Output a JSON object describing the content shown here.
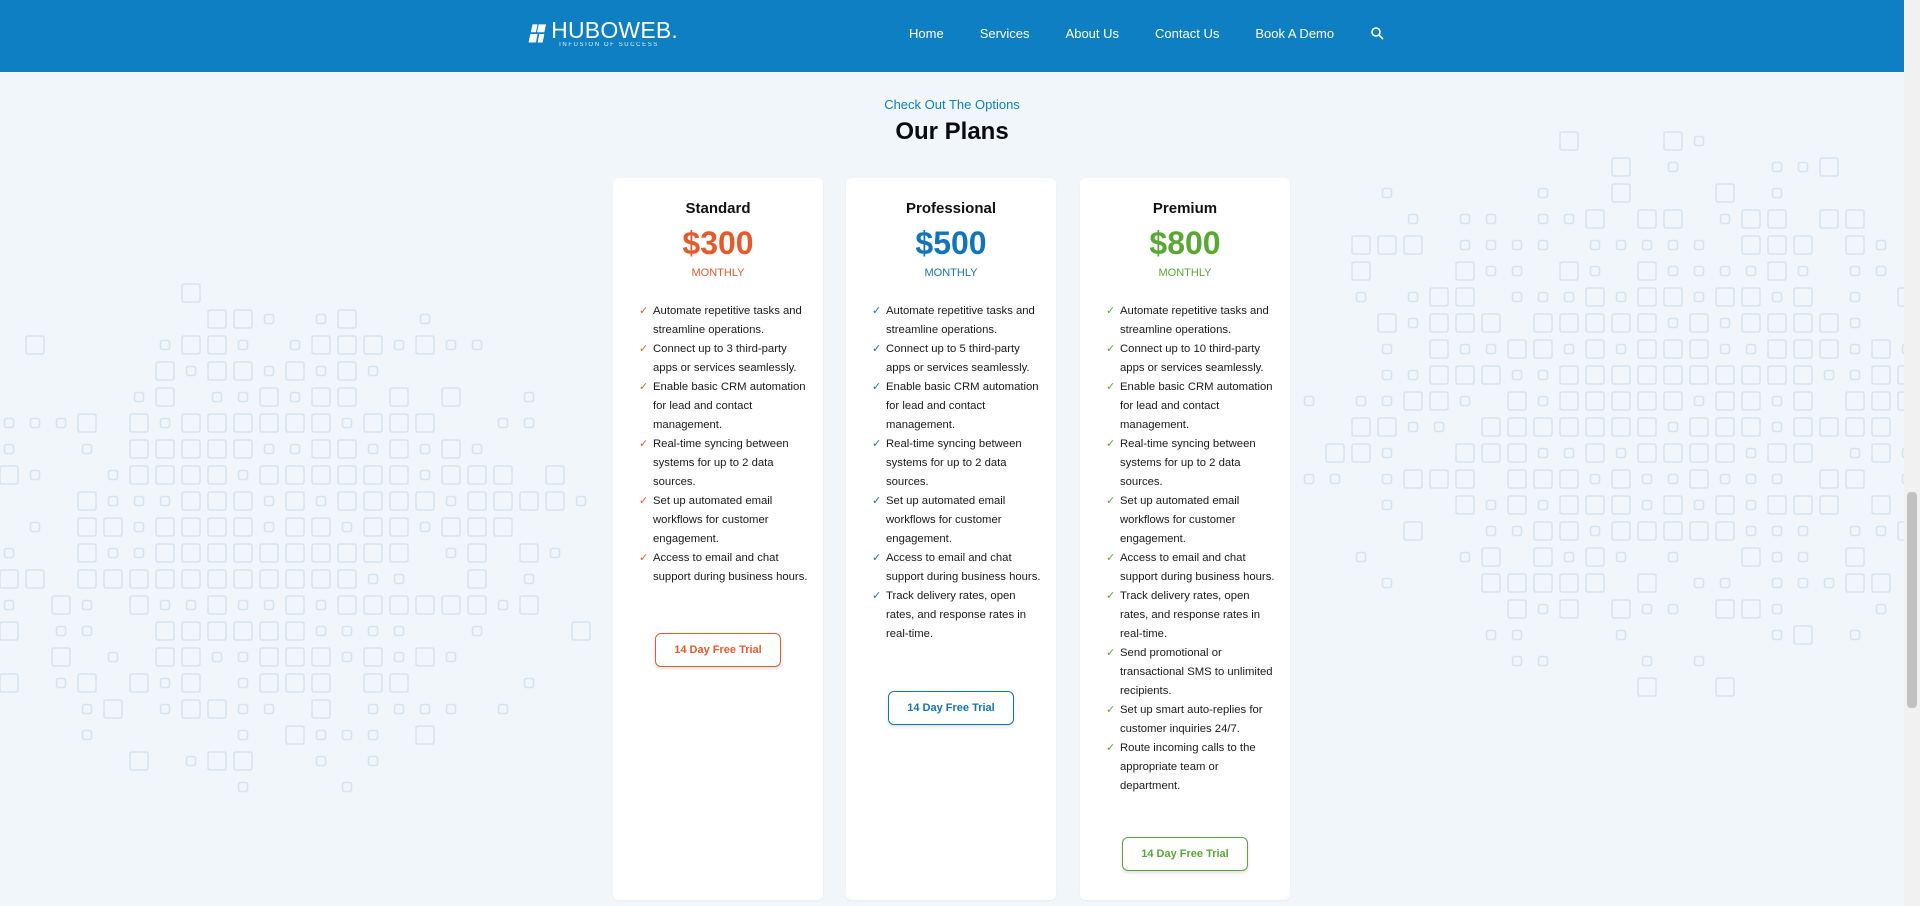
{
  "brand": {
    "name": "HUBOWEB.",
    "tagline": "INFUSION OF SUCCESS"
  },
  "nav": {
    "links": [
      "Home",
      "Services",
      "About Us",
      "Contact Us",
      "Book A Demo"
    ],
    "search_icon": "search-icon"
  },
  "section": {
    "kicker": "Check Out The Options",
    "title": "Our Plans"
  },
  "colors": {
    "nav_bg": "#0d7fc2",
    "standard": "#e55a2b",
    "professional": "#1274b9",
    "premium": "#5aa834"
  },
  "plans": [
    {
      "name": "Standard",
      "price": "$300",
      "period": "MONTHLY",
      "features": [
        "Automate repetitive tasks and streamline operations.",
        "Connect up to 3 third-party apps or services seamlessly.",
        "Enable basic CRM automation for lead and contact management.",
        "Real-time syncing between systems for up to 2 data sources.",
        "Set up automated email workflows for customer engagement.",
        "Access to email and chat support during business hours."
      ],
      "cta": "14 Day Free Trial"
    },
    {
      "name": "Professional",
      "price": "$500",
      "period": "MONTHLY",
      "features": [
        "Automate repetitive tasks and streamline operations.",
        "Connect up to 5 third-party apps or services seamlessly.",
        "Enable basic CRM automation for lead and contact management.",
        "Real-time syncing between systems for up to 2 data sources.",
        "Set up automated email workflows for customer engagement.",
        "Access to email and chat support during business hours.",
        "Track delivery rates, open rates, and response rates in real-time."
      ],
      "cta": "14 Day Free Trial"
    },
    {
      "name": "Premium",
      "price": "$800",
      "period": "MONTHLY",
      "features": [
        "Automate repetitive tasks and streamline operations.",
        "Connect up to 10 third-party apps or services seamlessly.",
        "Enable basic CRM automation for lead and contact management.",
        "Real-time syncing between systems for up to 2 data sources.",
        "Set up automated email workflows for customer engagement.",
        "Access to email and chat support during business hours.",
        "Track delivery rates, open rates, and response rates in real-time.",
        "Send promotional or transactional SMS to unlimited recipients.",
        "Set up smart auto-replies for customer inquiries 24/7.",
        "Route incoming calls to the appropriate team or department."
      ],
      "cta": "14 Day Free Trial"
    }
  ]
}
